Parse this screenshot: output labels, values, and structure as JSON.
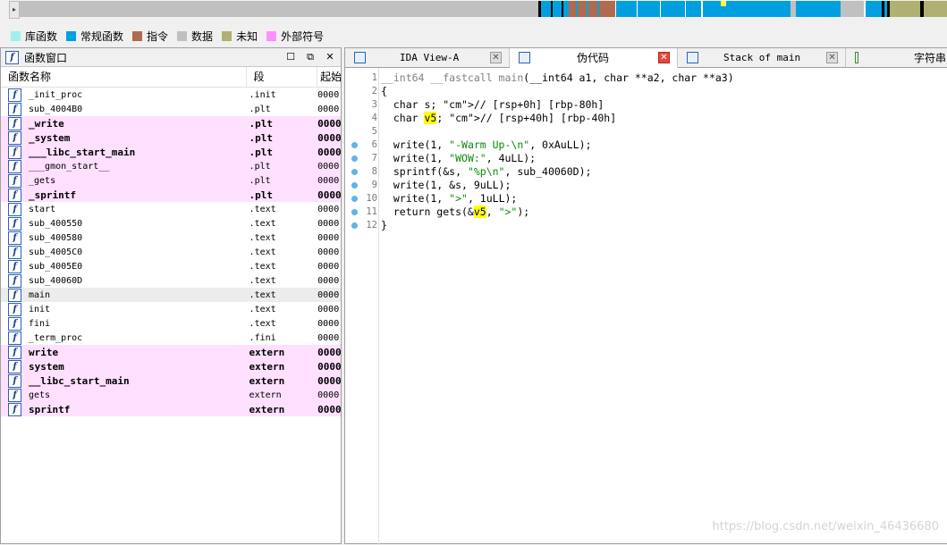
{
  "legend": [
    {
      "label": "库函数",
      "color": "#a0f0f0"
    },
    {
      "label": "常规函数",
      "color": "#00a0e0"
    },
    {
      "label": "指令",
      "color": "#b06a4e"
    },
    {
      "label": "数据",
      "color": "#c0c0c0"
    },
    {
      "label": "未知",
      "color": "#b0b070"
    },
    {
      "label": "外部符号",
      "color": "#ff90ff"
    }
  ],
  "functions_window": {
    "title": "函数窗口",
    "columns": [
      "函数名称",
      "段",
      "起始"
    ],
    "rows": [
      {
        "name": "_init_proc",
        "segment": ".init",
        "start": "0000",
        "lib": false,
        "bold": false
      },
      {
        "name": "sub_4004B0",
        "segment": ".plt",
        "start": "0000",
        "lib": false,
        "bold": false
      },
      {
        "name": "_write",
        "segment": ".plt",
        "start": "0000",
        "lib": true,
        "bold": true
      },
      {
        "name": "_system",
        "segment": ".plt",
        "start": "0000",
        "lib": true,
        "bold": true
      },
      {
        "name": "___libc_start_main",
        "segment": ".plt",
        "start": "0000",
        "lib": true,
        "bold": true
      },
      {
        "name": "___gmon_start__",
        "segment": ".plt",
        "start": "0000",
        "lib": true,
        "bold": false
      },
      {
        "name": "_gets",
        "segment": ".plt",
        "start": "0000",
        "lib": true,
        "bold": false
      },
      {
        "name": "_sprintf",
        "segment": ".plt",
        "start": "0000",
        "lib": true,
        "bold": true
      },
      {
        "name": "start",
        "segment": ".text",
        "start": "0000",
        "lib": false,
        "bold": false
      },
      {
        "name": "sub_400550",
        "segment": ".text",
        "start": "0000",
        "lib": false,
        "bold": false
      },
      {
        "name": "sub_400580",
        "segment": ".text",
        "start": "0000",
        "lib": false,
        "bold": false
      },
      {
        "name": "sub_4005C0",
        "segment": ".text",
        "start": "0000",
        "lib": false,
        "bold": false
      },
      {
        "name": "sub_4005E0",
        "segment": ".text",
        "start": "0000",
        "lib": false,
        "bold": false
      },
      {
        "name": "sub_40060D",
        "segment": ".text",
        "start": "0000",
        "lib": false,
        "bold": false
      },
      {
        "name": "main",
        "segment": ".text",
        "start": "0000",
        "lib": false,
        "bold": false,
        "selected": true
      },
      {
        "name": "init",
        "segment": ".text",
        "start": "0000",
        "lib": false,
        "bold": false
      },
      {
        "name": "fini",
        "segment": ".text",
        "start": "0000",
        "lib": false,
        "bold": false
      },
      {
        "name": "_term_proc",
        "segment": ".fini",
        "start": "0000",
        "lib": false,
        "bold": false
      },
      {
        "name": "write",
        "segment": "extern",
        "start": "0000",
        "lib": true,
        "bold": true
      },
      {
        "name": "system",
        "segment": "extern",
        "start": "0000",
        "lib": true,
        "bold": true
      },
      {
        "name": "__libc_start_main",
        "segment": "extern",
        "start": "0000",
        "lib": true,
        "bold": true
      },
      {
        "name": "gets",
        "segment": "extern",
        "start": "0000",
        "lib": true,
        "bold": false
      },
      {
        "name": "sprintf",
        "segment": "extern",
        "start": "0000",
        "lib": true,
        "bold": true
      }
    ]
  },
  "tabs": [
    {
      "label": "IDA View-A"
    },
    {
      "label": "伪代码"
    },
    {
      "label": "Stack of main"
    },
    {
      "label": "字符串"
    }
  ],
  "code_lines": [
    {
      "n": "1",
      "text": "__int64 __fastcall main(__int64 a1, char **a2, char **a3)",
      "bp": false
    },
    {
      "n": "2",
      "text": "{",
      "bp": false
    },
    {
      "n": "3",
      "text": "  char s; // [rsp+0h] [rbp-80h]",
      "bp": false
    },
    {
      "n": "4",
      "text": "  char v5; // [rsp+40h] [rbp-40h]",
      "bp": false
    },
    {
      "n": "5",
      "text": "",
      "bp": false
    },
    {
      "n": "6",
      "text": "  write(1, \"-Warm Up-\\n\", 0xAuLL);",
      "bp": true
    },
    {
      "n": "7",
      "text": "  write(1, \"WOW:\", 4uLL);",
      "bp": true
    },
    {
      "n": "8",
      "text": "  sprintf(&s, \"%p\\n\", sub_40060D);",
      "bp": true
    },
    {
      "n": "9",
      "text": "  write(1, &s, 9uLL);",
      "bp": true
    },
    {
      "n": "10",
      "text": "  write(1, \">\", 1uLL);",
      "bp": true
    },
    {
      "n": "11",
      "text": "  return gets(&v5, \">\");",
      "bp": true
    },
    {
      "n": "12",
      "text": "}",
      "bp": true
    }
  ],
  "watermark": "https://blog.csdn.net/weixin_46436680"
}
